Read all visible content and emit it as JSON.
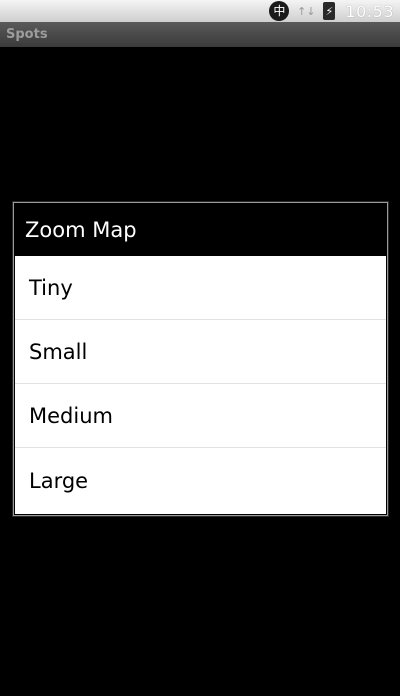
{
  "status_bar": {
    "ime_label": "中",
    "signal_label": "↑↓",
    "battery_label": "⚡",
    "time": "10:53"
  },
  "app": {
    "title": "Spots"
  },
  "dialog": {
    "title": "Zoom Map",
    "items": [
      {
        "label": "Tiny"
      },
      {
        "label": "Small"
      },
      {
        "label": "Medium"
      },
      {
        "label": "Large"
      }
    ]
  }
}
